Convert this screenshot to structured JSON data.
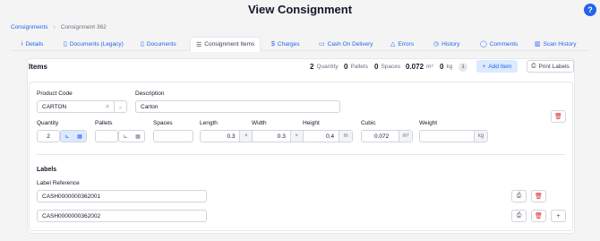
{
  "page": {
    "title": "View Consignment",
    "help": "?"
  },
  "breadcrumb": {
    "root": "Consignments",
    "current": "Consignment 362"
  },
  "tabs": [
    {
      "label": "Details",
      "icon": "i"
    },
    {
      "label": "Documents (Legacy)",
      "icon": "▯"
    },
    {
      "label": "Documents",
      "icon": "▯"
    },
    {
      "label": "Consignment Items",
      "icon": "☰"
    },
    {
      "label": "Charges",
      "icon": "$"
    },
    {
      "label": "Cash On Delivery",
      "icon": "▭"
    },
    {
      "label": "Errors",
      "icon": "△"
    },
    {
      "label": "History",
      "icon": "◷"
    },
    {
      "label": "Comments",
      "icon": "◯"
    },
    {
      "label": "Scan History",
      "icon": "▥"
    }
  ],
  "items": {
    "title": "Items",
    "quantity_value": "2",
    "quantity_label": "Quantity",
    "pallets_value": "0",
    "pallets_label": "Pallets",
    "spaces_value": "0",
    "spaces_label": "Spaces",
    "cubic_value": "0.072",
    "cubic_unit": "m³",
    "weight_value": "0",
    "weight_unit": "kg",
    "count_badge": "1",
    "add_label": "Add Item",
    "print_label": "Print Labels"
  },
  "form": {
    "product_code_label": "Product Code",
    "product_code_value": "CARTON",
    "description_label": "Description",
    "description_value": "Carton",
    "quantity_label": "Quantity",
    "quantity_value": "2",
    "pallets_label": "Pallets",
    "pallets_value": "",
    "spaces_label": "Spaces",
    "spaces_value": "",
    "length_label": "Length",
    "length_value": "0.3",
    "width_label": "Width",
    "width_value": "0.3",
    "height_label": "Height",
    "height_value": "0.4",
    "dim_unit": "m",
    "cubic_label": "Cubic",
    "cubic_value": "0.072",
    "cubic_unit": "m³",
    "weight_label": "Weight",
    "weight_value": "",
    "weight_unit": "kg",
    "times": "×"
  },
  "labels": {
    "section_title": "Labels",
    "ref_label": "Label Reference",
    "refs": [
      "CASH0000000362001",
      "CASH0000000362002"
    ]
  },
  "icons": {
    "add": "+",
    "print": "⎙",
    "trash": "🗑",
    "clear": "✕",
    "chevron": "⌄"
  },
  "colors": {
    "accent": "#2563eb",
    "danger": "#dc2626"
  }
}
